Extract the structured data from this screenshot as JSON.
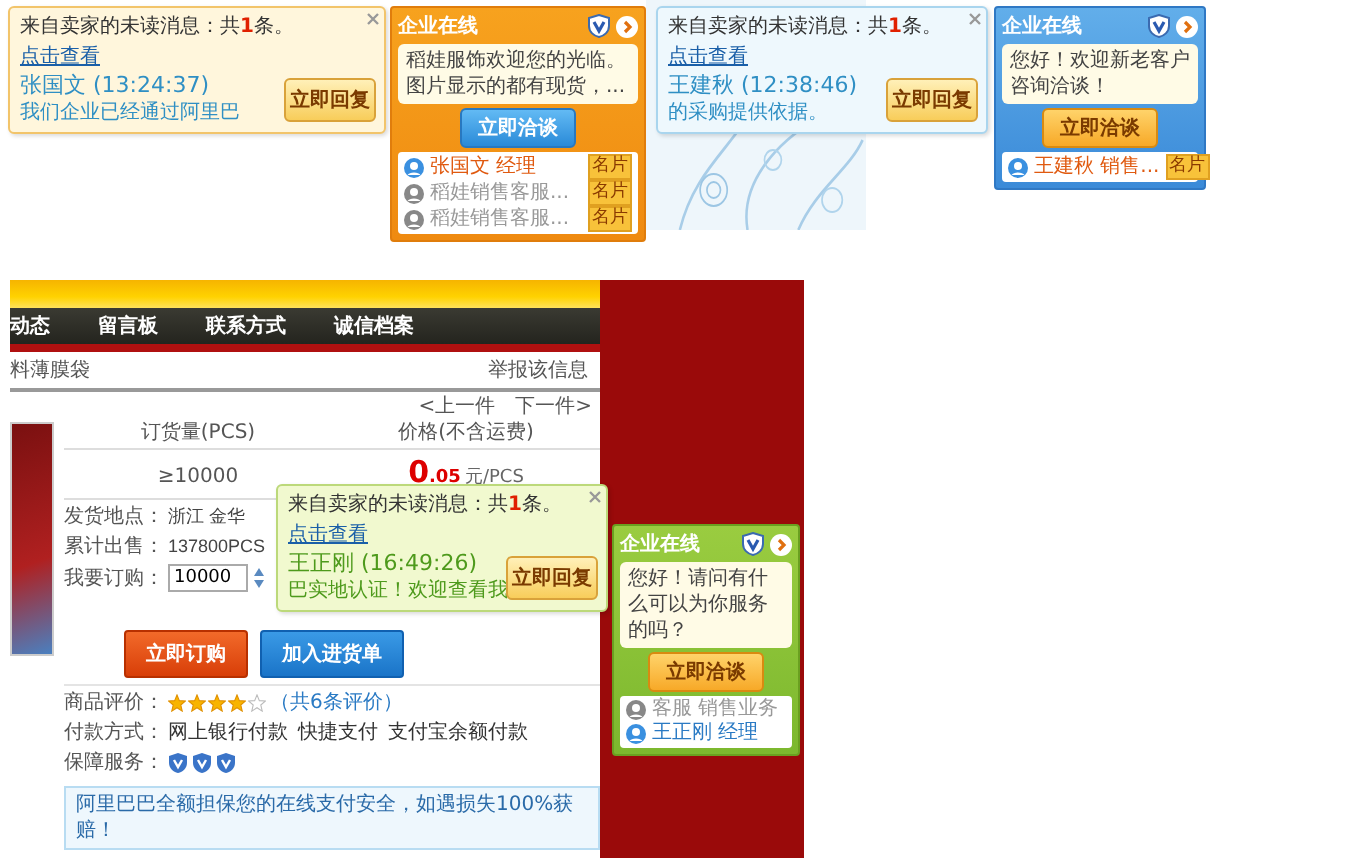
{
  "panels": [
    {
      "notification": {
        "unread": "来自卖家的未读消息：共**1**条。",
        "link": "点击查看",
        "sender": "张国文 (13:24:37)",
        "message": "我们企业已经通过阿里巴",
        "reply_button": "立即回复"
      },
      "widget": {
        "title": "企业在线",
        "greeting": "稻娃服饰欢迎您的光临。图片显示的都有现货，...",
        "chat_button": "立即洽谈",
        "contacts": [
          {
            "name": "张国文 经理",
            "online": true,
            "badge": "名片"
          },
          {
            "name": "稻娃销售客服...",
            "online": false,
            "badge": "名片"
          },
          {
            "name": "稻娃销售客服...",
            "online": false,
            "badge": "名片"
          }
        ]
      }
    },
    {
      "notification": {
        "unread": "来自卖家的未读消息：共**1**条。",
        "link": "点击查看",
        "sender": "王建秋 (12:38:46)",
        "message": "的采购提供依据。",
        "reply_button": "立即回复"
      },
      "widget": {
        "title": "企业在线",
        "greeting": "您好！欢迎新老客户咨询洽谈！",
        "chat_button": "立即洽谈",
        "contacts": [
          {
            "name": "王建秋 销售...",
            "online": true,
            "badge": "名片"
          }
        ]
      }
    }
  ],
  "product_page": {
    "nav": [
      "动态",
      "留言板",
      "联系方式",
      "诚信档案"
    ],
    "breadcrumb": "料薄膜袋",
    "report_link": "举报该信息",
    "prev": "<上一件",
    "next": "下一件>",
    "table": {
      "columns": [
        "订货量(PCS)",
        "价格(不含运费)"
      ],
      "rows": [
        {
          "quantity": "≥10000",
          "price_integer": "0",
          "price_decimals": ".05",
          "unit": "元/PCS"
        }
      ]
    },
    "details": [
      {
        "label": "发货地点：",
        "value": "浙江 金华"
      },
      {
        "label": "累计出售：",
        "value": "137800PCS"
      }
    ],
    "order": {
      "label": "我要订购：",
      "value": "10000"
    },
    "buy_button": "立即订购",
    "cart_button": "加入进货单",
    "rating": {
      "label": "商品评价：",
      "stars": 4,
      "count": "（共6条评价）"
    },
    "payment": {
      "label": "付款方式：",
      "methods": [
        "网上银行付款",
        "快捷支付",
        "支付宝余额付款"
      ]
    },
    "guarantee": {
      "label": "保障服务："
    },
    "notice": "阿里巴巴全额担保您的在线支付安全，如遇损失100%获赔！"
  },
  "overlay": {
    "notification": {
      "unread": "来自卖家的未读消息：共**1**条。",
      "link": "点击查看",
      "sender": "王正刚 (16:49:26)",
      "message": "巴实地认证！欢迎查看我",
      "reply_button": "立即回复"
    },
    "widget": {
      "title": "企业在线",
      "greeting": "您好！请问有什么可以为你服务的吗？",
      "chat_button": "立即洽谈",
      "contacts": [
        {
          "name": "客服 销售业务",
          "online": false
        },
        {
          "name": "王正刚 经理",
          "online": true
        }
      ]
    }
  }
}
